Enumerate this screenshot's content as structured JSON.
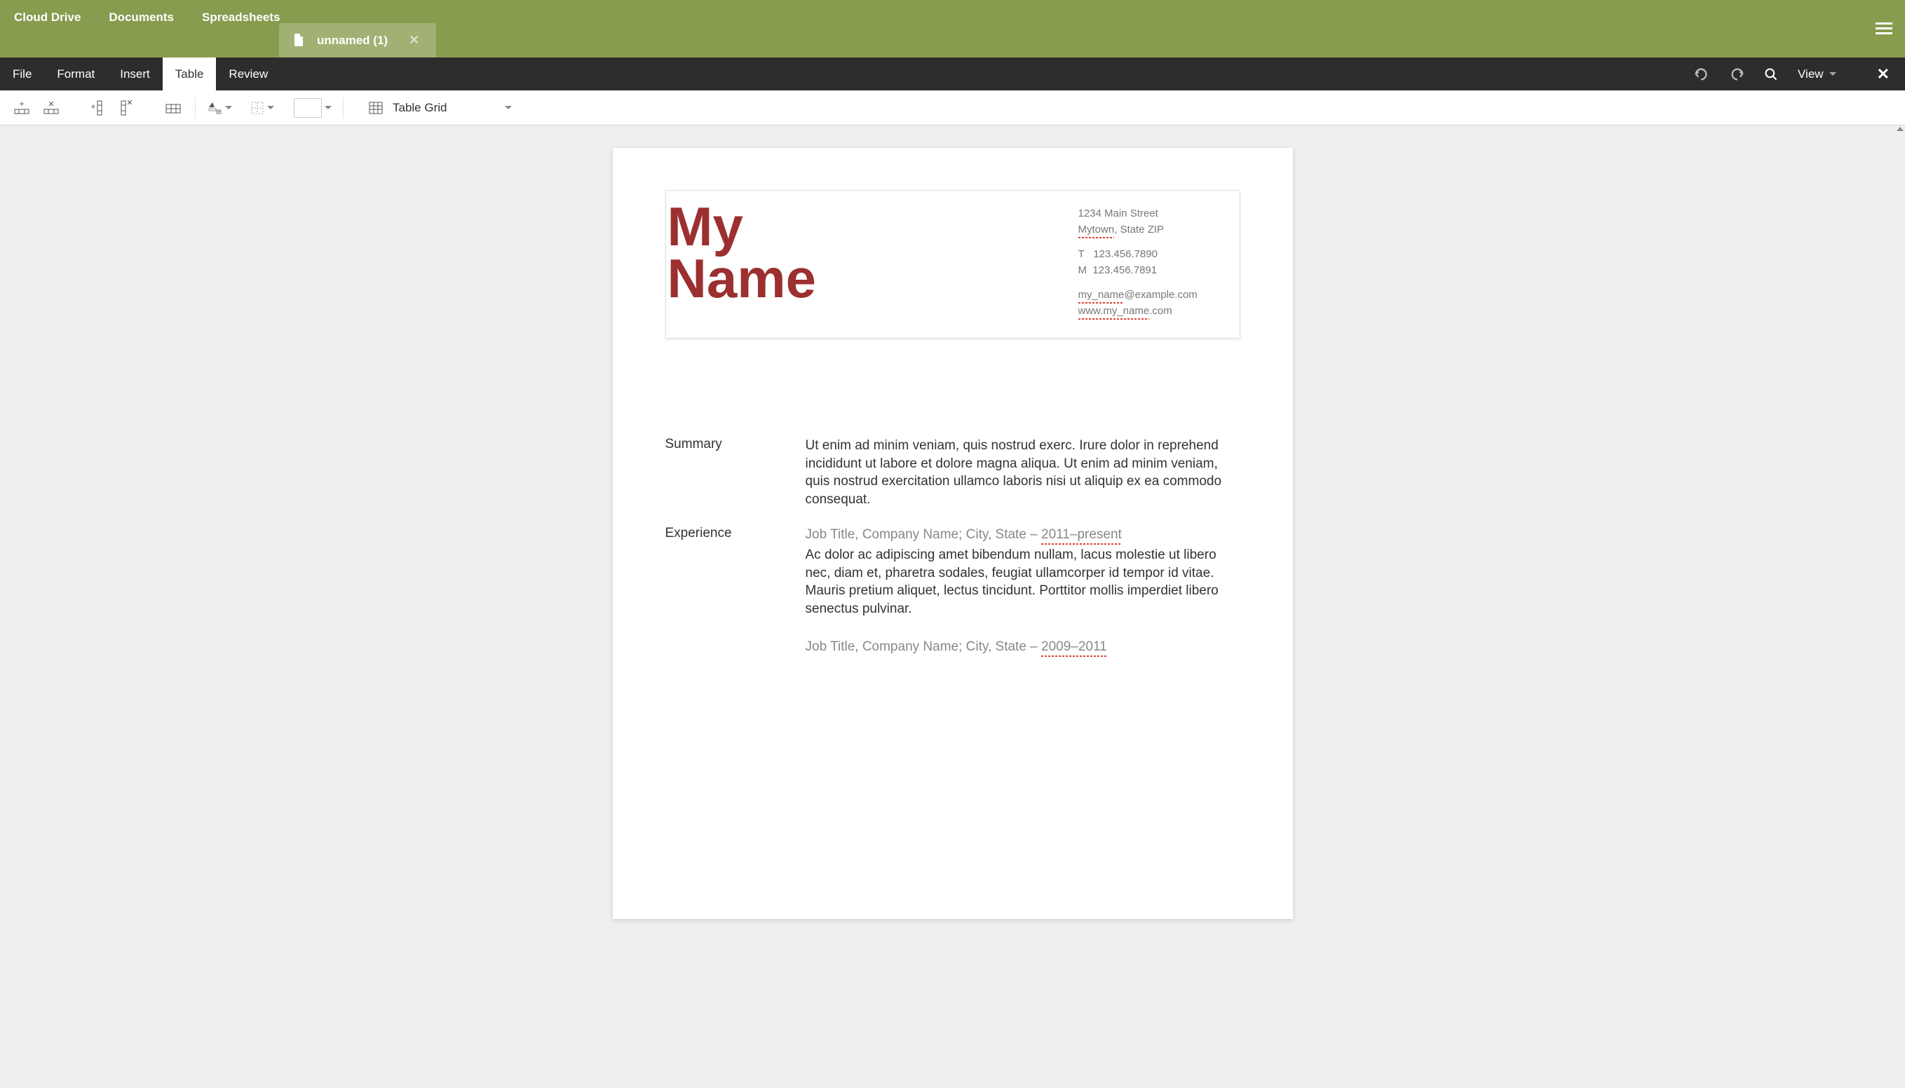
{
  "topNav": {
    "cloudDrive": "Cloud Drive",
    "documents": "Documents",
    "spreadsheets": "Spreadsheets"
  },
  "docTab": {
    "name": "unnamed (1)"
  },
  "menuBar": {
    "file": "File",
    "format": "Format",
    "insert": "Insert",
    "table": "Table",
    "review": "Review",
    "view": "View"
  },
  "toolbar": {
    "tableStyle": "Table Grid"
  },
  "document": {
    "name": {
      "line1": "My",
      "line2": "Name"
    },
    "contact": {
      "address1": "1234 Main Street",
      "address2_city": "Mytown",
      "address2_rest": ", State ZIP",
      "phoneT_label": "T",
      "phoneT_value": "123.456.7890",
      "phoneM_label": "M",
      "phoneM_value": "123.456.7891",
      "email_user": "my_name",
      "email_domain": "@example.com",
      "website_prefix": "www.",
      "website_mid": "my_name",
      "website_suffix": ".com"
    },
    "sections": {
      "summary": {
        "label": "Summary",
        "text": "Ut enim ad minim veniam, quis nostrud exerc. Irure dolor in reprehend incididunt ut labore et dolore magna aliqua. Ut enim ad minim veniam, quis nostrud exercitation ullamco laboris nisi ut aliquip ex ea commodo consequat."
      },
      "experience": {
        "label": "Experience",
        "job1": {
          "header": "Job Title, Company Name; City, State – ",
          "dates": "2011–present",
          "desc": "Ac dolor ac adipiscing amet bibendum nullam, lacus molestie ut libero nec, diam et, pharetra sodales, feugiat ullamcorper id tempor id vitae. Mauris pretium aliquet, lectus tincidunt. Porttitor mollis imperdiet libero senectus pulvinar."
        },
        "job2": {
          "header": "Job Title, Company Name; City, State – ",
          "dates": "2009–2011"
        }
      }
    }
  }
}
